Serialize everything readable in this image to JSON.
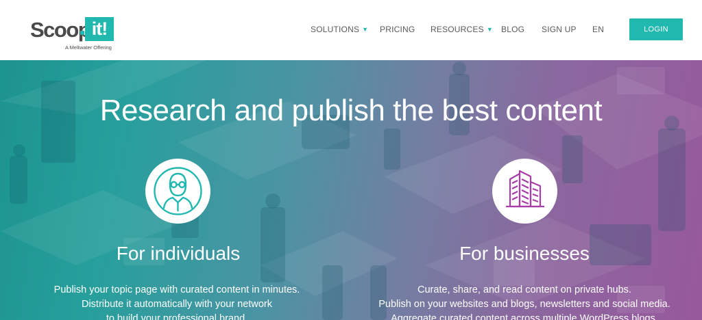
{
  "brand": {
    "logo_main": "Scoop",
    "logo_it": "it!",
    "tagline": "A Meltwater Offering"
  },
  "nav": {
    "items": [
      {
        "label": "SOLUTIONS",
        "dropdown": true
      },
      {
        "label": "PRICING",
        "dropdown": false
      },
      {
        "label": "RESOURCES",
        "dropdown": true
      },
      {
        "label": "BLOG",
        "dropdown": false
      },
      {
        "label": "SIGN UP",
        "dropdown": false
      },
      {
        "label": "EN",
        "dropdown": false
      }
    ],
    "login_label": "LOGIN"
  },
  "hero": {
    "title": "Research and publish the best content",
    "individuals": {
      "icon": "person-icon",
      "title": "For individuals",
      "lines": [
        "Publish your topic page with curated content in minutes.",
        "Distribute it automatically with your network",
        "to build your professional brand."
      ]
    },
    "businesses": {
      "icon": "building-icon",
      "title": "For businesses",
      "lines": [
        "Curate, share, and read content on private hubs.",
        "Publish on your websites and blogs, newsletters and social media.",
        "Aggregate curated content across multiple WordPress blogs."
      ]
    }
  },
  "colors": {
    "accent": "#21b8b0",
    "individual_icon": "#21b8b0",
    "business_icon": "#a63ea6"
  }
}
